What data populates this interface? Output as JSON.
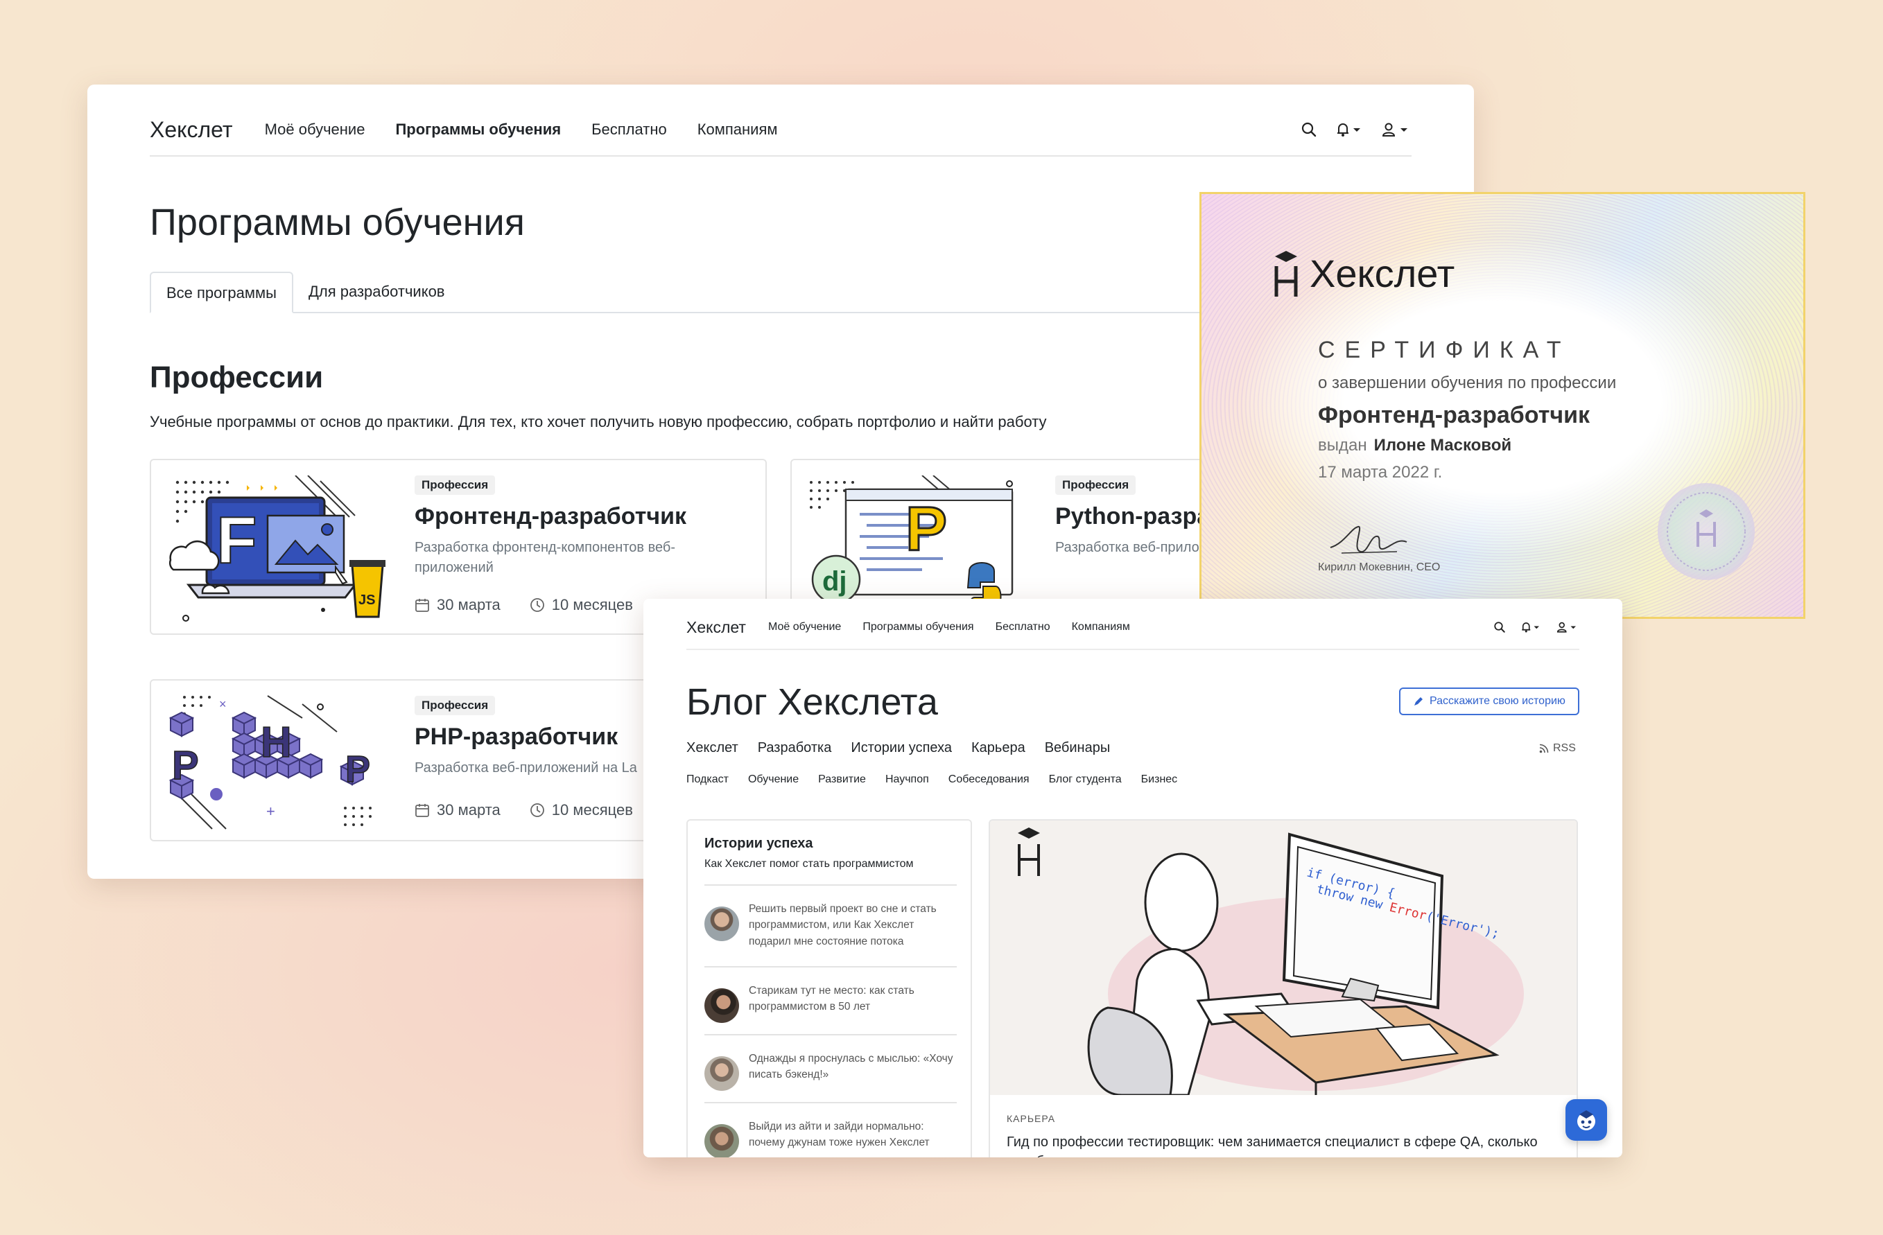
{
  "programs_window": {
    "nav": {
      "logo": "Хекслет",
      "links": [
        "Моё обучение",
        "Программы обучения",
        "Бесплатно",
        "Компаниям"
      ]
    },
    "title": "Программы обучения",
    "tabs": [
      "Все программы",
      "Для разработчиков"
    ],
    "section_title": "Профессии",
    "section_lead": "Учебные программы от основ до практики. Для тех, кто хочет получить новую профессию, собрать портфолио и найти работу",
    "cards": [
      {
        "badge": "Профессия",
        "title": "Фронтенд-разработчик",
        "description": "Разработка фронтенд-компонентов веб-приложений",
        "start": "30 марта",
        "duration": "10 месяцев"
      },
      {
        "badge": "Профессия",
        "title": "Python-разра",
        "description": "Разработка веб-прило"
      },
      {
        "badge": "Профессия",
        "title": "PHP-разработчик",
        "description": "Разработка веб-приложений на La",
        "start": "30 марта",
        "duration": "10 месяцев"
      }
    ]
  },
  "certificate": {
    "logo": "Хекслет",
    "heading": "СЕРТИФИКАТ",
    "subtitle": "о завершении обучения по профессии",
    "profession": "Фронтенд-разработчик",
    "issued_label": "выдан",
    "recipient": "Илоне Масковой",
    "date": "17 марта 2022 г.",
    "signature": "Кирилл Мокевнин, CEO"
  },
  "blog_window": {
    "nav": {
      "logo": "Хекслет",
      "links": [
        "Моё обучение",
        "Программы обучения",
        "Бесплатно",
        "Компаниям"
      ]
    },
    "title": "Блог Хекслета",
    "share_button": "Расскажите свою историю",
    "categories": [
      "Хекслет",
      "Разработка",
      "Истории успеха",
      "Карьера",
      "Вебинары"
    ],
    "rss": "RSS",
    "subcategories": [
      "Подкаст",
      "Обучение",
      "Развитие",
      "Научпоп",
      "Собеседования",
      "Блог студента",
      "Бизнес"
    ],
    "stories": {
      "title": "Истории успеха",
      "subtitle": "Как Хекслет помог стать программистом",
      "items": [
        "Решить первый проект во сне и стать программистом, или Как Хекслет подарил мне состояние потока",
        "Старикам тут не место: как стать программистом в 50 лет",
        "Однажды я проснулась с мыслью: «Хочу писать бэкенд!»",
        "Выйди из айти и зайди нормально: почему джунам тоже нужен Хекслет"
      ]
    },
    "featured": {
      "kicker": "КАРЬЕРА",
      "title": "Гид по профессии тестировщик: чем занимается специалист в сфере QA, сколько зарабатывает, что надо знать и где учиться"
    }
  }
}
